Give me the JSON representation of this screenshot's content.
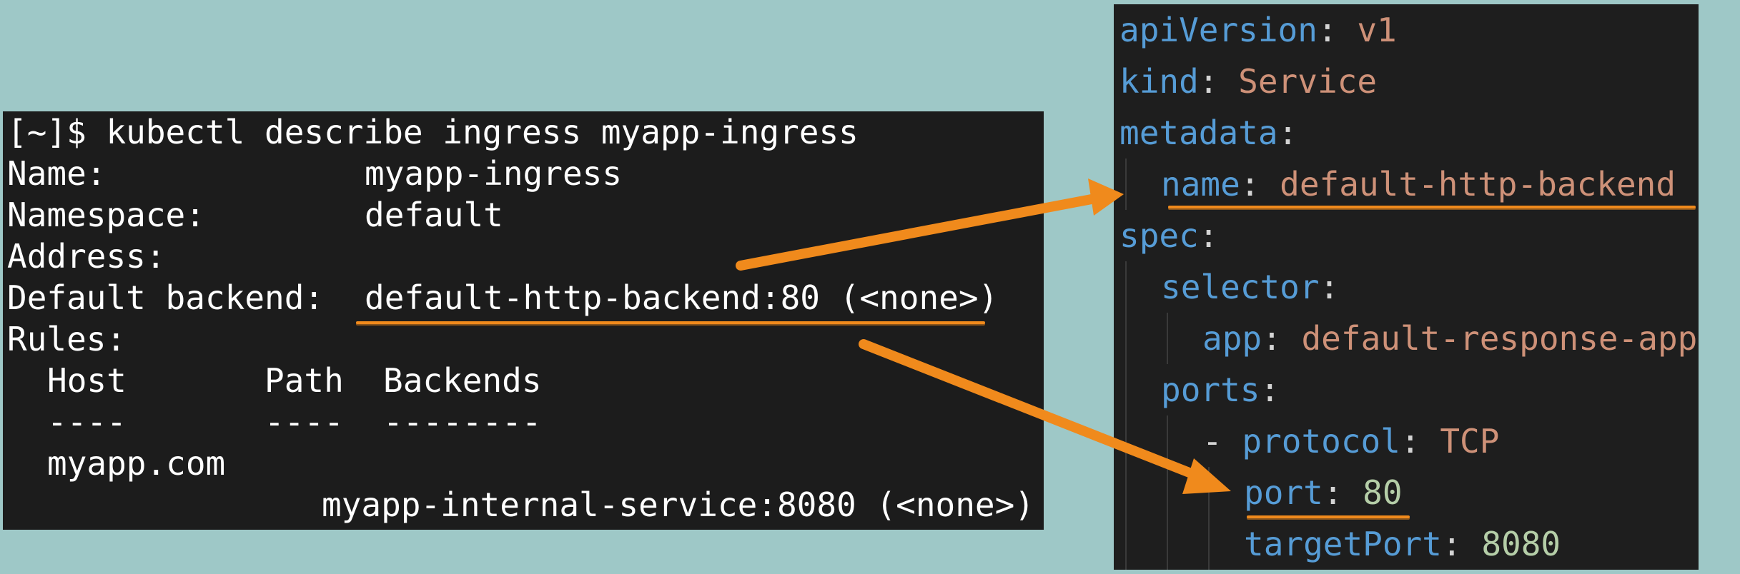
{
  "terminal": {
    "prompt_line": "[~]$ kubectl describe ingress myapp-ingress",
    "name_label": "Name:",
    "name_value": "myapp-ingress",
    "namespace_label": "Namespace:",
    "namespace_value": "default",
    "address_label": "Address:",
    "default_backend_label": "Default backend:",
    "default_backend_value": "default-http-backend:80 (<none>)",
    "rules_label": "Rules:",
    "rules_header": {
      "host": "Host",
      "path": "Path",
      "backends": "Backends"
    },
    "rules_separator": {
      "host": "----",
      "path": "----",
      "backends": "--------"
    },
    "rule_host": "myapp.com",
    "rule_backend": "myapp-internal-service:8080 (<none>)"
  },
  "yaml": {
    "apiVersion_key": "apiVersion",
    "apiVersion_value": "v1",
    "kind_key": "kind",
    "kind_value": "Service",
    "metadata_key": "metadata",
    "name_key": "name",
    "name_value": "default-http-backend",
    "spec_key": "spec",
    "selector_key": "selector",
    "app_key": "app",
    "app_value": "default-response-app",
    "ports_key": "ports",
    "dash": "- ",
    "protocol_key": "protocol",
    "protocol_value": "TCP",
    "port_key": "port",
    "port_value": "80",
    "targetPort_key": "targetPort",
    "targetPort_value": "8080",
    "colon": ": "
  },
  "colors": {
    "background": "#9ec8c7",
    "terminal_bg": "#1c1c1c",
    "editor_bg": "#1e1e1e",
    "yaml_key": "#569cd6",
    "yaml_string": "#ce9178",
    "yaml_number": "#b5cea8",
    "annotation": "#f08a1c"
  }
}
